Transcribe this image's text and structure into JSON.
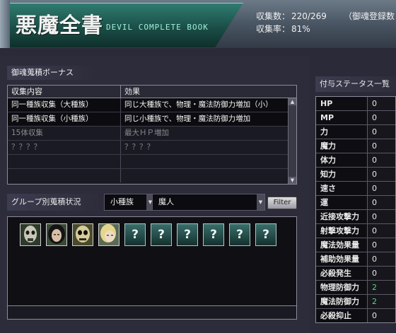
{
  "header": {
    "title": "悪魔全書",
    "subtitle": "DEVIL COMPLETE BOOK",
    "collect_count_label": "収集数：",
    "collect_count_value": "220/269",
    "registered_label": "（御魂登録数",
    "collect_rate_label": "収集率：",
    "collect_rate_value": "81%"
  },
  "bonus": {
    "title": "御魂蒐積ボーナス",
    "col_content": "収集内容",
    "col_effect": "効果",
    "rows": [
      {
        "content": "同一種族収集（大種族）",
        "effect": "同じ大種族で、物理・魔法防御力増加（小）"
      },
      {
        "content": "同一種族収集（小種族）",
        "effect": "同じ小種族で、物理・魔法防御力増加"
      },
      {
        "content": "15体収集",
        "effect": "最大ＨＰ増加"
      },
      {
        "content": "？？？？",
        "effect": "？？？？"
      },
      {
        "content": "",
        "effect": ""
      },
      {
        "content": "",
        "effect": ""
      }
    ]
  },
  "group": {
    "title": "グループ別蒐積状況",
    "category_select": "小種族",
    "race_select": "魔人",
    "filter_button": "Filter",
    "unknown_glyph": "?"
  },
  "status": {
    "title": "付与ステータス一覧",
    "rows": [
      {
        "key": "HP",
        "value": "0"
      },
      {
        "key": "MP",
        "value": "0"
      },
      {
        "key": "力",
        "value": "0"
      },
      {
        "key": "魔力",
        "value": "0"
      },
      {
        "key": "体力",
        "value": "0"
      },
      {
        "key": "知力",
        "value": "0"
      },
      {
        "key": "速さ",
        "value": "0"
      },
      {
        "key": "運",
        "value": "0"
      },
      {
        "key": "近接攻撃力",
        "value": "0"
      },
      {
        "key": "射撃攻撃力",
        "value": "0"
      },
      {
        "key": "魔法効果量",
        "value": "0"
      },
      {
        "key": "補助効果量",
        "value": "0"
      },
      {
        "key": "必殺発生",
        "value": "0"
      },
      {
        "key": "物理防御力",
        "value": "2"
      },
      {
        "key": "魔法防御力",
        "value": "2"
      },
      {
        "key": "必殺抑止",
        "value": "0"
      }
    ]
  },
  "colors": {
    "accent_teal": "#2f7c70",
    "bonus_green": "#56d87e"
  }
}
